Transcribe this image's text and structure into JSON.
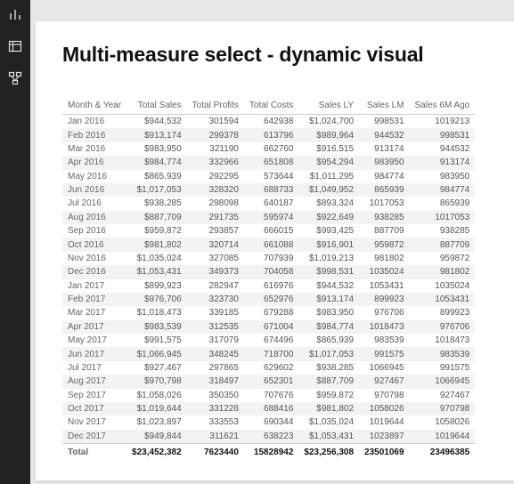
{
  "sidebar": {
    "icons": [
      "bar-chart-icon",
      "table-icon",
      "model-icon"
    ]
  },
  "title": "Multi-measure select - dynamic visual",
  "chart_data": {
    "type": "table",
    "columns": [
      "Month & Year",
      "Total Sales",
      "Total Profits",
      "Total Costs",
      "Sales LY",
      "Sales LM",
      "Sales 6M Ago"
    ],
    "rows": [
      [
        "Jan 2016",
        "$944,532",
        "301594",
        "642938",
        "$1,024,700",
        "998531",
        "1019213"
      ],
      [
        "Feb 2016",
        "$913,174",
        "299378",
        "613796",
        "$989,964",
        "944532",
        "998531"
      ],
      [
        "Mar 2016",
        "$983,950",
        "321190",
        "662760",
        "$916,515",
        "913174",
        "944532"
      ],
      [
        "Apr 2016",
        "$984,774",
        "332966",
        "651808",
        "$954,294",
        "983950",
        "913174"
      ],
      [
        "May 2016",
        "$865,939",
        "292295",
        "573644",
        "$1,011,295",
        "984774",
        "983950"
      ],
      [
        "Jun 2016",
        "$1,017,053",
        "328320",
        "688733",
        "$1,049,952",
        "865939",
        "984774"
      ],
      [
        "Jul 2016",
        "$938,285",
        "298098",
        "640187",
        "$893,324",
        "1017053",
        "865939"
      ],
      [
        "Aug 2016",
        "$887,709",
        "291735",
        "595974",
        "$922,649",
        "938285",
        "1017053"
      ],
      [
        "Sep 2016",
        "$959,872",
        "293857",
        "666015",
        "$993,425",
        "887709",
        "938285"
      ],
      [
        "Oct 2016",
        "$981,802",
        "320714",
        "661088",
        "$916,901",
        "959872",
        "887709"
      ],
      [
        "Nov 2016",
        "$1,035,024",
        "327085",
        "707939",
        "$1,019,213",
        "981802",
        "959872"
      ],
      [
        "Dec 2016",
        "$1,053,431",
        "349373",
        "704058",
        "$998,531",
        "1035024",
        "981802"
      ],
      [
        "Jan 2017",
        "$899,923",
        "282947",
        "616976",
        "$944,532",
        "1053431",
        "1035024"
      ],
      [
        "Feb 2017",
        "$976,706",
        "323730",
        "652976",
        "$913,174",
        "899923",
        "1053431"
      ],
      [
        "Mar 2017",
        "$1,018,473",
        "339185",
        "679288",
        "$983,950",
        "976706",
        "899923"
      ],
      [
        "Apr 2017",
        "$983,539",
        "312535",
        "671004",
        "$984,774",
        "1018473",
        "976706"
      ],
      [
        "May 2017",
        "$991,575",
        "317079",
        "674496",
        "$865,939",
        "983539",
        "1018473"
      ],
      [
        "Jun 2017",
        "$1,066,945",
        "348245",
        "718700",
        "$1,017,053",
        "991575",
        "983539"
      ],
      [
        "Jul 2017",
        "$927,467",
        "297865",
        "629602",
        "$938,285",
        "1066945",
        "991575"
      ],
      [
        "Aug 2017",
        "$970,798",
        "318497",
        "652301",
        "$887,709",
        "927467",
        "1066945"
      ],
      [
        "Sep 2017",
        "$1,058,026",
        "350350",
        "707676",
        "$959,872",
        "970798",
        "927467"
      ],
      [
        "Oct 2017",
        "$1,019,644",
        "331228",
        "688416",
        "$981,802",
        "1058026",
        "970798"
      ],
      [
        "Nov 2017",
        "$1,023,897",
        "333553",
        "690344",
        "$1,035,024",
        "1019644",
        "1058026"
      ],
      [
        "Dec 2017",
        "$949,844",
        "311621",
        "638223",
        "$1,053,431",
        "1023897",
        "1019644"
      ]
    ],
    "totals": [
      "Total",
      "$23,452,382",
      "7623440",
      "15828942",
      "$23,256,308",
      "23501069",
      "23496385"
    ]
  }
}
